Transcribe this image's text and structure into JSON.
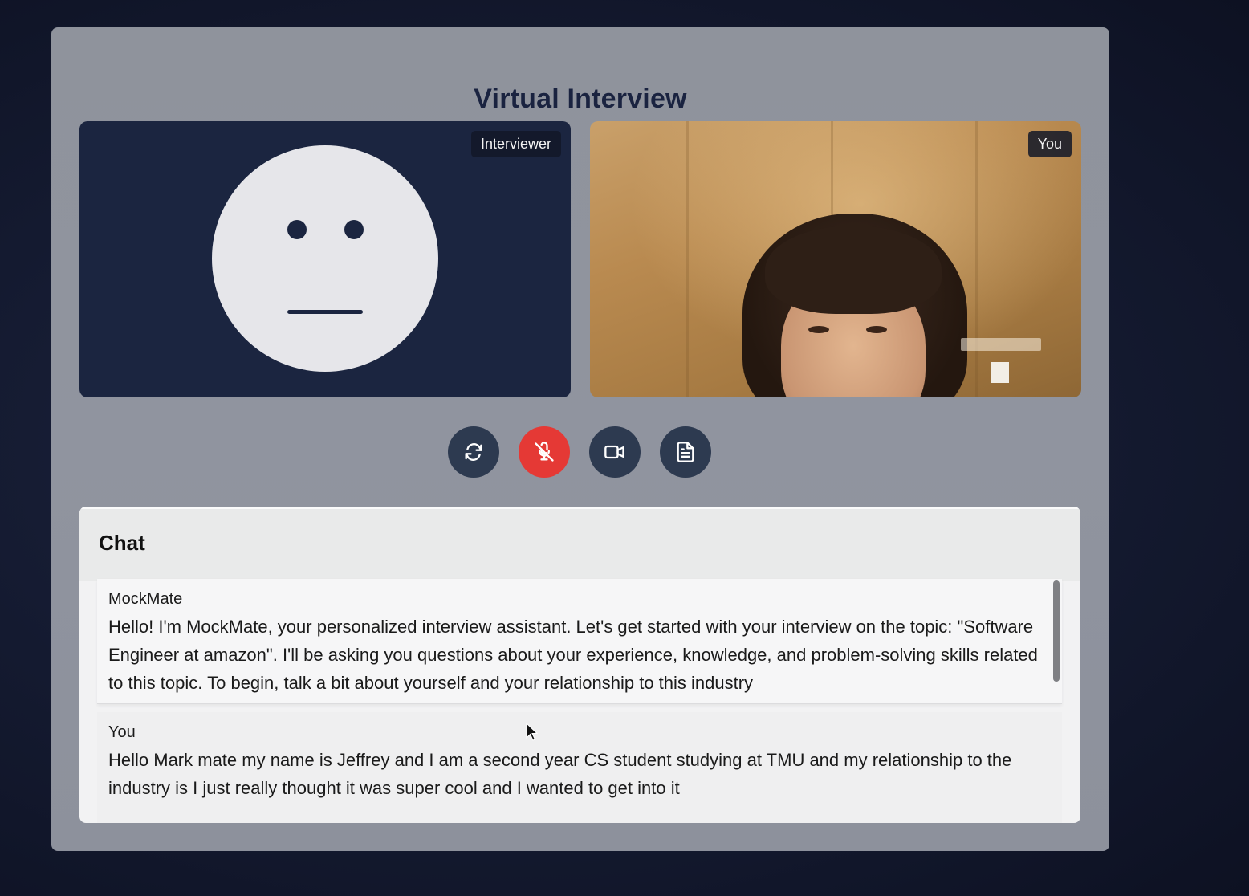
{
  "page": {
    "title": "Virtual Interview"
  },
  "tiles": {
    "interviewer_label": "Interviewer",
    "you_label": "You"
  },
  "controls": [
    {
      "name": "switch-camera-icon",
      "state": "default"
    },
    {
      "name": "mic-off-icon",
      "state": "muted"
    },
    {
      "name": "video-camera-icon",
      "state": "default"
    },
    {
      "name": "document-icon",
      "state": "default"
    }
  ],
  "colors": {
    "panel": "#8f939c",
    "interviewer_bg": "#1b2540",
    "control_bg": "#2d3a50",
    "muted_red": "#e53935"
  },
  "chat": {
    "title": "Chat",
    "messages": [
      {
        "sender": "MockMate",
        "text": "Hello! I'm MockMate, your personalized interview assistant. Let's get started with your interview on the topic: \"Software Engineer at amazon\". I'll be asking you questions about your experience, knowledge, and problem-solving skills related to this topic. To begin, talk a bit about yourself and your relationship to this industry"
      },
      {
        "sender": "You",
        "text": "Hello Mark mate my name is Jeffrey and I am a second year CS student studying at TMU and my relationship to the industry is I just really thought it was super cool and I wanted to get into it"
      }
    ]
  }
}
